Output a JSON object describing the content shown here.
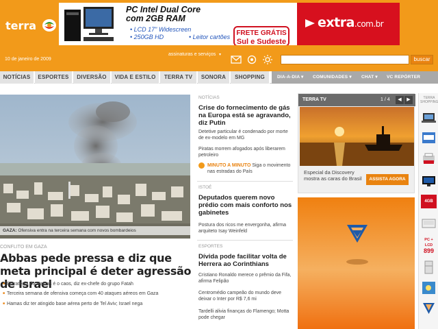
{
  "header": {
    "logo": "terra",
    "date": "10 de janeiro de 2009",
    "services_label": "assinaturas e serviços",
    "search_placeholder": "",
    "search_button": "buscar",
    "icons": [
      "mail-icon",
      "messenger-icon",
      "weather-icon"
    ]
  },
  "banner": {
    "title_line1": "PC Intel Dual Core",
    "title_line2": "com 2GB RAM",
    "spec1": "• LCD 17\" Widescreen",
    "spec2": "• 250GB HD",
    "spec3": "• Leitor cartões",
    "frete_line1": "FRETE GRÁTIS",
    "frete_line2": "Sul e Sudeste",
    "extra_brand": "extra",
    "extra_domain": ".com.br"
  },
  "nav": {
    "items": [
      "NOTÍCIAS",
      "ESPORTES",
      "DIVERSÃO",
      "VIDA E ESTILO",
      "TERRA TV",
      "SONORA",
      "SHOPPING"
    ],
    "sub_items": [
      "DIA-A-DIA",
      "COMUNIDADES",
      "CHAT",
      "VC REPÓRTER"
    ]
  },
  "main": {
    "caption_place": "GAZA:",
    "caption_text": " Ofensiva entra na terceira semana com novos bombardeios",
    "kicker": "CONFLITO EM GAZA",
    "headline": "Abbas pede pressa e diz que meta principal é deter agressão de Israel",
    "bullets": [
      "Estratégia do Hamas é o caos, diz ex-chefe do grupo Fatah",
      "Terceira semana de ofensiva começa com 40 ataques aéreos em Gaza",
      "Hamas diz ter atingido base aérea perto de Tel Aviv; Israel nega"
    ]
  },
  "center": {
    "news_kicker": "NOTÍCIAS",
    "news_headline": "Crise do fornecimento de gás na Europa está se agravando, diz Putin",
    "news_item1": "Detetive particular é condenado por morte de ex-modelo em MG",
    "news_item2": "Piratas morrem afogados após liberarem petroleiro",
    "minute_label": "MINUTO A MINUTO",
    "minute_text": " Siga o movimento nas estradas do País",
    "istoe_kicker": "ISTOÉ",
    "istoe_headline": "Deputados querem novo prédio com mais conforto nos gabinetes",
    "istoe_item": "Postura dos ricos me envergonha, afirma arquiteto Isay Weinfeld",
    "sports_kicker": "ESPORTES",
    "sports_headline": "Dívida pode facilitar volta de Herrera ao Corinthians",
    "sports_item1": "Cristiano Ronaldo merece o prêmio da Fifa, afirma Felipão",
    "sports_item2": "Centromédio campeão do mundo deve deixar o Inter por R$ 7,6 mi",
    "sports_item3": "Tardelli alivia finanças do Flamengo; Motta pode chegar"
  },
  "tv": {
    "label": "TERRA TV",
    "counter": "1 / 4",
    "prev": "◀",
    "next": "▶",
    "text": "Especial da Discovery mostra as caras do Brasil",
    "watch_button": "ASSISTA AGORA"
  },
  "shopping": {
    "label": "TERRA SHOPPING",
    "items": [
      "laptop",
      "sale-tag",
      "printer",
      "tv-screen",
      "memory-4gb",
      "notebook",
      "pc-lcd",
      "fridge",
      "bird-toy",
      "triangle-logo"
    ],
    "price_text": "PC + LCD",
    "price_value": "899",
    "memory_text": "4GB"
  },
  "colors": {
    "brand_orange": "#f29a1a",
    "accent_red": "#d7101e",
    "nav_gray": "#e3e3e3"
  }
}
